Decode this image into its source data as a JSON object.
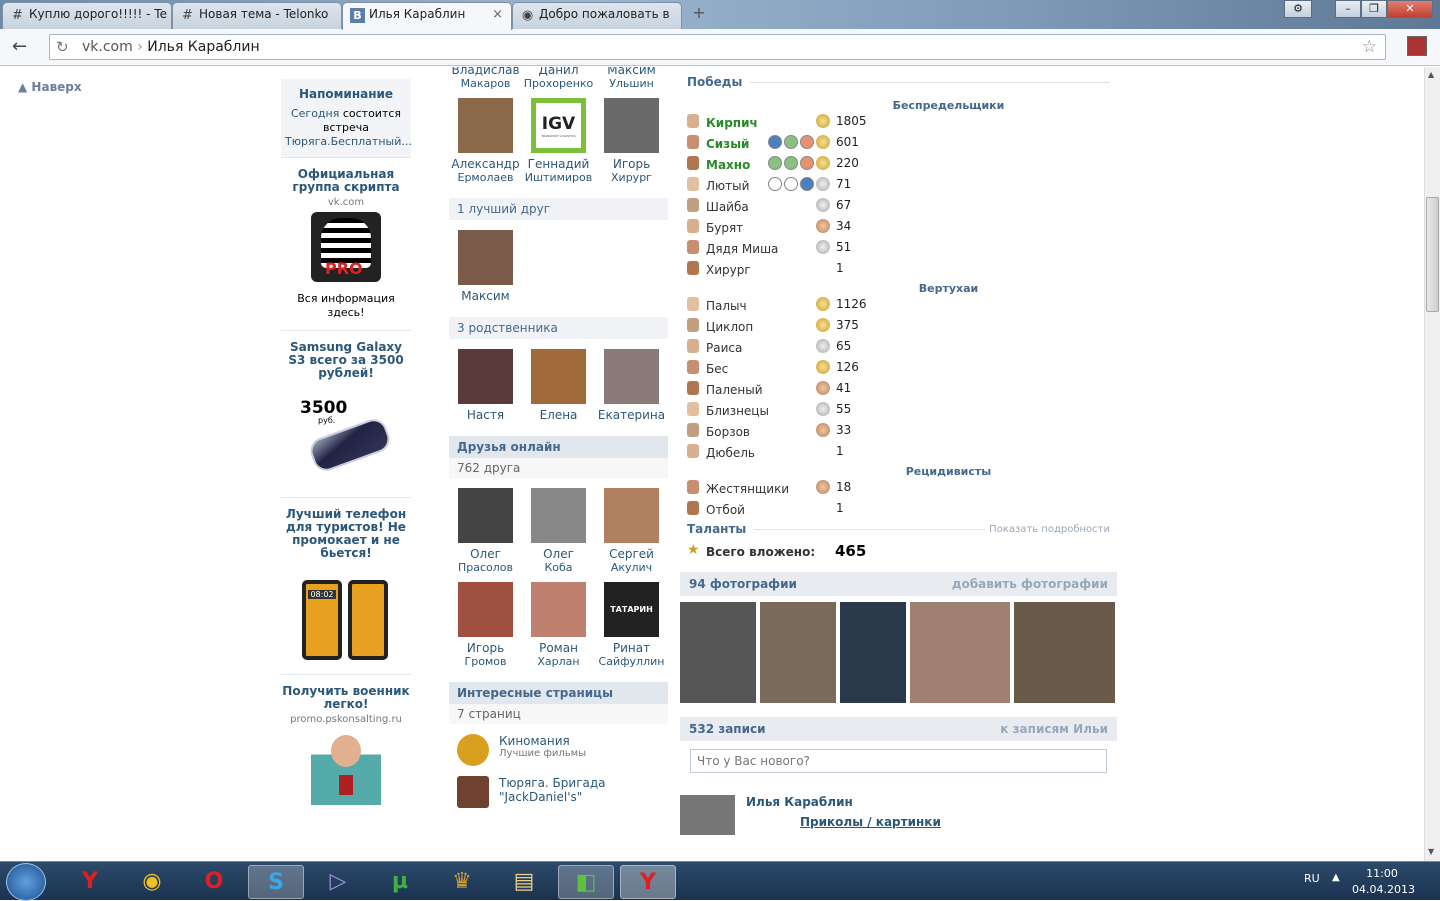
{
  "browser": {
    "tabs": [
      {
        "title": "Куплю дорого!!!!! - Te",
        "icon": "hash-icon"
      },
      {
        "title": "Новая тема - Telonko",
        "icon": "hash-icon"
      },
      {
        "title": "Илья Караблин",
        "icon": "vk-icon",
        "active": true
      },
      {
        "title": "Добро пожаловать в",
        "icon": "steam-icon"
      }
    ],
    "url_host": "vk.com",
    "url_sep": "›",
    "url_path": "Илья Караблин"
  },
  "nav": {
    "up_label": "Наверх"
  },
  "left": {
    "reminder": {
      "title": "Напоминание",
      "today": "Сегодня",
      "text": "состоится встреча",
      "link": "Тюряга.Бесплатный..."
    },
    "ads": [
      {
        "title": "Официальная группа скрипта",
        "domain": "vk.com",
        "text": "Вся информация здесь!"
      },
      {
        "title": "Samsung Galaxy S3 всего за 3500 рублей!",
        "price": "3500",
        "currency": "руб."
      },
      {
        "title": "Лучший телефон для туристов! Не промокает и не бьется!",
        "phone_time": "08:02"
      },
      {
        "title": "Получить военник легко!",
        "domain": "promo.pskonsalting.ru"
      }
    ]
  },
  "middle": {
    "friends_top": [
      {
        "first": "Владислав",
        "last": "Макаров"
      },
      {
        "first": "Данил",
        "last": "Прохоренко"
      },
      {
        "first": "Максим",
        "last": "Ульшин"
      },
      {
        "first": "Александр",
        "last": "Ермолаев",
        "color": "#8a6a4a"
      },
      {
        "first": "Геннадий",
        "last": "Иштимиров",
        "color": "#7bbf3a",
        "logo": "IGV",
        "logo_sub": "TRANSPORT LOGISTICS"
      },
      {
        "first": "Игорь",
        "last": "Хирург",
        "color": "#6a6a6a"
      }
    ],
    "best_friend_header": "1 лучший друг",
    "best_friend": {
      "first": "Максим",
      "color": "#7a5a48"
    },
    "relatives_header": "3 родственника",
    "relatives": [
      {
        "first": "Настя",
        "color": "#5a3a3a"
      },
      {
        "first": "Елена",
        "color": "#a06a3a"
      },
      {
        "first": "Екатерина",
        "color": "#8a7a7a"
      }
    ],
    "online_header": "Друзья онлайн",
    "online_count": "762 друга",
    "online": [
      {
        "first": "Олег",
        "last": "Прасолов",
        "color": "#444"
      },
      {
        "first": "Олег",
        "last": "Коба",
        "color": "#888"
      },
      {
        "first": "Сергей",
        "last": "Акулич",
        "color": "#b08060"
      },
      {
        "first": "Игорь",
        "last": "Громов",
        "color": "#a05040"
      },
      {
        "first": "Роман",
        "last": "Харлан",
        "color": "#c08070"
      },
      {
        "first": "Ринат",
        "last": "Сайфуллин",
        "color": "#222",
        "label": "ТАТАРИН"
      }
    ],
    "pages_header": "Интересные страницы",
    "pages_count": "7 страниц",
    "pages": [
      {
        "title": "Киномания",
        "sub": "Лучшие фильмы",
        "color": "#d9a020"
      },
      {
        "title": "Тюряга. Бригада \"JackDaniel's\"",
        "sub": "",
        "color": "#704030"
      }
    ]
  },
  "right": {
    "wins_header": "Победы",
    "gangs": [
      {
        "name": "Беспредельщики",
        "members": [
          {
            "name": "Кирпич",
            "green": true,
            "balls": [],
            "coin": "gold",
            "value": "1805"
          },
          {
            "name": "Сизый",
            "green": true,
            "balls": [
              "blue",
              "green",
              "orange"
            ],
            "coin": "gold",
            "value": "601"
          },
          {
            "name": "Махно",
            "green": true,
            "balls": [
              "green",
              "green",
              "orange"
            ],
            "coin": "gold",
            "value": "220"
          },
          {
            "name": "Лютый",
            "green": false,
            "balls": [
              "empty",
              "empty",
              "blue"
            ],
            "coin": "silver",
            "value": "71"
          },
          {
            "name": "Шайба",
            "green": false,
            "balls": [],
            "coin": "silver",
            "value": "67"
          },
          {
            "name": "Бурят",
            "green": false,
            "balls": [],
            "coin": "bronze",
            "value": "34"
          },
          {
            "name": "Дядя Миша",
            "green": false,
            "balls": [],
            "coin": "silver",
            "value": "51"
          },
          {
            "name": "Хирург",
            "green": false,
            "balls": [],
            "coin": "none",
            "value": "1"
          }
        ]
      },
      {
        "name": "Вертухаи",
        "members": [
          {
            "name": "Палыч",
            "green": false,
            "balls": [],
            "coin": "gold",
            "value": "1126"
          },
          {
            "name": "Циклоп",
            "green": false,
            "balls": [],
            "coin": "gold",
            "value": "375"
          },
          {
            "name": "Раиса",
            "green": false,
            "balls": [],
            "coin": "silver",
            "value": "65"
          },
          {
            "name": "Бес",
            "green": false,
            "balls": [],
            "coin": "gold",
            "value": "126"
          },
          {
            "name": "Паленый",
            "green": false,
            "balls": [],
            "coin": "bronze",
            "value": "41"
          },
          {
            "name": "Близнецы",
            "green": false,
            "balls": [],
            "coin": "silver",
            "value": "55"
          },
          {
            "name": "Борзов",
            "green": false,
            "balls": [],
            "coin": "bronze",
            "value": "33"
          },
          {
            "name": "Дюбель",
            "green": false,
            "balls": [],
            "coin": "none",
            "value": "1"
          }
        ]
      },
      {
        "name": "Рецидивисты",
        "members": [
          {
            "name": "Жестянщики",
            "green": false,
            "balls": [],
            "coin": "bronze",
            "value": "18"
          },
          {
            "name": "Отбой",
            "green": false,
            "balls": [],
            "coin": "none",
            "value": "1"
          }
        ]
      }
    ],
    "talents_header": "Таланты",
    "talents_link": "Показать подробности",
    "invested_label": "Всего вложено:",
    "invested_value": "465",
    "photos_header": "94 фотографии",
    "photos_action": "добавить фотографии",
    "photo_colors": [
      "#555",
      "#7a6a5a",
      "#2a3a4a",
      "#a08070",
      "#6a5a4a"
    ],
    "wall_header": "532 записи",
    "wall_action": "к записям Ильи",
    "status_placeholder": "Что у Вас нового?",
    "post_author": "Илья Караблин",
    "post_link": "Приколы / картинки"
  },
  "taskbar": {
    "lang": "RU",
    "time": "11:00",
    "date": "04.04.2013"
  },
  "colors": {
    "vk_blue": "#45688e",
    "link": "#2b587a",
    "green_name": "#2a8a2a"
  }
}
